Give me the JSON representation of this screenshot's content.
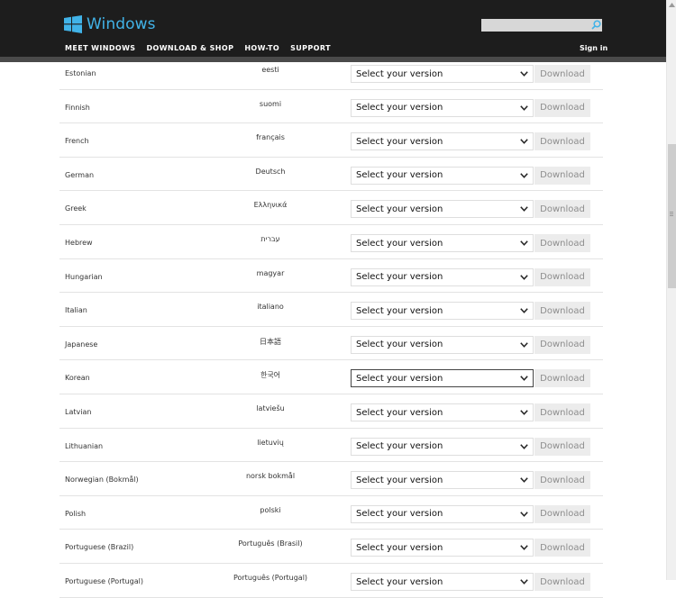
{
  "header": {
    "logo_text": "Windows",
    "nav": [
      "MEET WINDOWS",
      "DOWNLOAD & SHOP",
      "HOW-TO",
      "SUPPORT"
    ],
    "sign_in": "Sign in",
    "search_placeholder": "",
    "brand_color": "#41b3e8"
  },
  "rows": [
    {
      "language": "Estonian",
      "native": "eesti",
      "select": "Select your version",
      "download": "Download"
    },
    {
      "language": "Finnish",
      "native": "suomi",
      "select": "Select your version",
      "download": "Download"
    },
    {
      "language": "French",
      "native": "français",
      "select": "Select your version",
      "download": "Download"
    },
    {
      "language": "German",
      "native": "Deutsch",
      "select": "Select your version",
      "download": "Download"
    },
    {
      "language": "Greek",
      "native": "Ελληνικά",
      "select": "Select your version",
      "download": "Download"
    },
    {
      "language": "Hebrew",
      "native": "עברית",
      "select": "Select your version",
      "download": "Download"
    },
    {
      "language": "Hungarian",
      "native": "magyar",
      "select": "Select your version",
      "download": "Download"
    },
    {
      "language": "Italian",
      "native": "italiano",
      "select": "Select your version",
      "download": "Download"
    },
    {
      "language": "Japanese",
      "native": "日本語",
      "select": "Select your version",
      "download": "Download"
    },
    {
      "language": "Korean",
      "native": "한국어",
      "select": "Select your version",
      "download": "Download",
      "focused": true
    },
    {
      "language": "Latvian",
      "native": "latviešu",
      "select": "Select your version",
      "download": "Download"
    },
    {
      "language": "Lithuanian",
      "native": "lietuvių",
      "select": "Select your version",
      "download": "Download"
    },
    {
      "language": "Norwegian (Bokmål)",
      "native": "norsk bokmål",
      "select": "Select your version",
      "download": "Download"
    },
    {
      "language": "Polish",
      "native": "polski",
      "select": "Select your version",
      "download": "Download"
    },
    {
      "language": "Portuguese (Brazil)",
      "native": "Português (Brasil)",
      "select": "Select your version",
      "download": "Download"
    },
    {
      "language": "Portuguese (Portugal)",
      "native": "Português (Portugal)",
      "select": "Select your version",
      "download": "Download"
    }
  ]
}
